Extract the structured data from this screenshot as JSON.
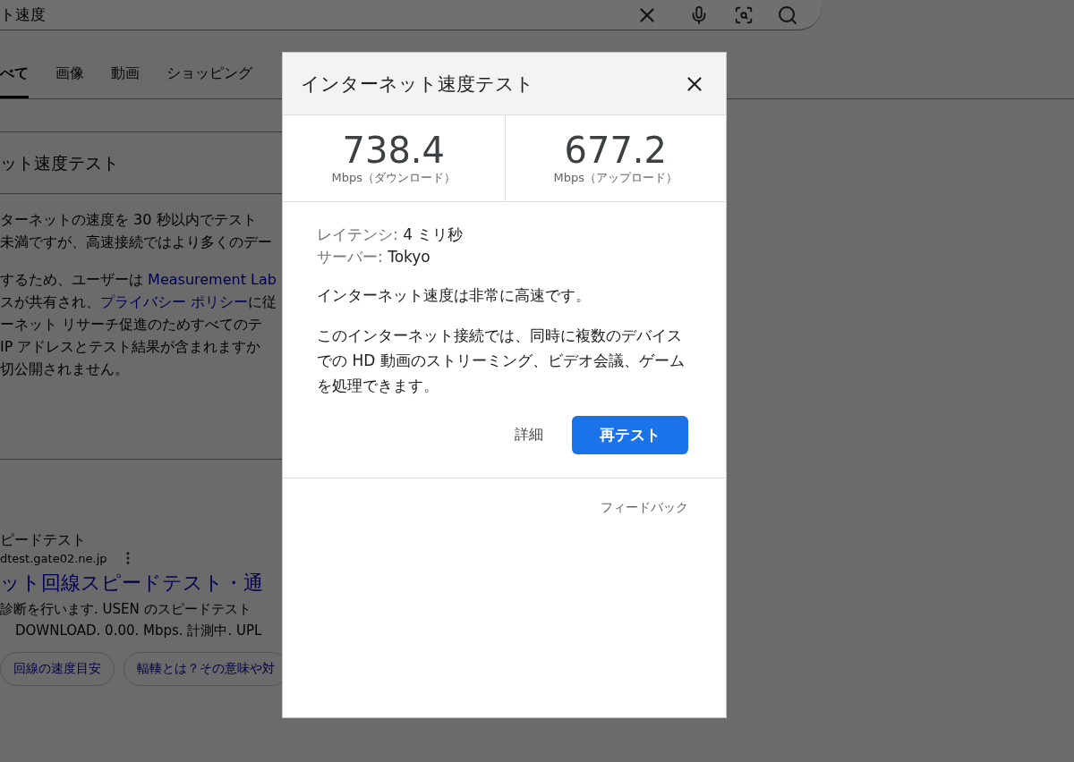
{
  "search_bar": {
    "query": "ト速度"
  },
  "tabs": [
    {
      "label": "べて",
      "selected": true
    },
    {
      "label": "画像",
      "selected": false
    },
    {
      "label": "動画",
      "selected": false
    },
    {
      "label": "ショッピング",
      "selected": false
    }
  ],
  "answer_card": {
    "heading": "ット速度テスト",
    "paragraphs": [
      [
        [
          {
            "text": "ターネットの速度を 30 秒以内でテスト",
            "link": false
          }
        ],
        [
          {
            "text": "未満ですが、高速接続ではより多くのデー",
            "link": false
          }
        ]
      ],
      [
        [
          {
            "text": "するため、ユーザーは ",
            "link": false
          },
          {
            "text": "Measurement Lab",
            "link": true
          }
        ],
        [
          {
            "text": "スが共有され、",
            "link": false
          },
          {
            "text": "プライバシー ポリシー",
            "link": true
          },
          {
            "text": "に従",
            "link": false
          }
        ],
        [
          {
            "text": "ーネット リサーチ促進のためすべてのテ",
            "link": false
          }
        ],
        [
          {
            "text": " IP アドレスとテスト結果が含まれますか",
            "link": false
          }
        ],
        [
          {
            "text": "切公開されません。",
            "link": false
          }
        ]
      ]
    ]
  },
  "result": {
    "site_name": "ピードテスト",
    "url": "dtest.gate02.ne.jp",
    "title": "ット回線スピードテスト・通",
    "snippet": [
      "診断を行います. USEN のスピードテスト",
      "DOWNLOAD. 0.00. Mbps. 計測中. UPL"
    ],
    "chips": [
      "回線の速度目安",
      "輻輳とは？その意味や対"
    ]
  },
  "dialog": {
    "title": "インターネット速度テスト",
    "results": [
      {
        "value": "738.4",
        "label": "Mbps（ダウンロード）"
      },
      {
        "value": "677.2",
        "label": "Mbps（アップロード）"
      }
    ],
    "details": [
      {
        "label": "レイテンシ:",
        "value": "4 ミリ秒"
      },
      {
        "label": "サーバー:",
        "value": "Tokyo"
      }
    ],
    "summary": "インターネット速度は非常に高速です。",
    "description": "このインターネット接続では、同時に複数のデバイスでの HD 動画のストリーミング、ビデオ会議、ゲームを処理できます。",
    "details_button": "詳細",
    "retest_button": "再テスト",
    "feedback": "フィードバック"
  }
}
